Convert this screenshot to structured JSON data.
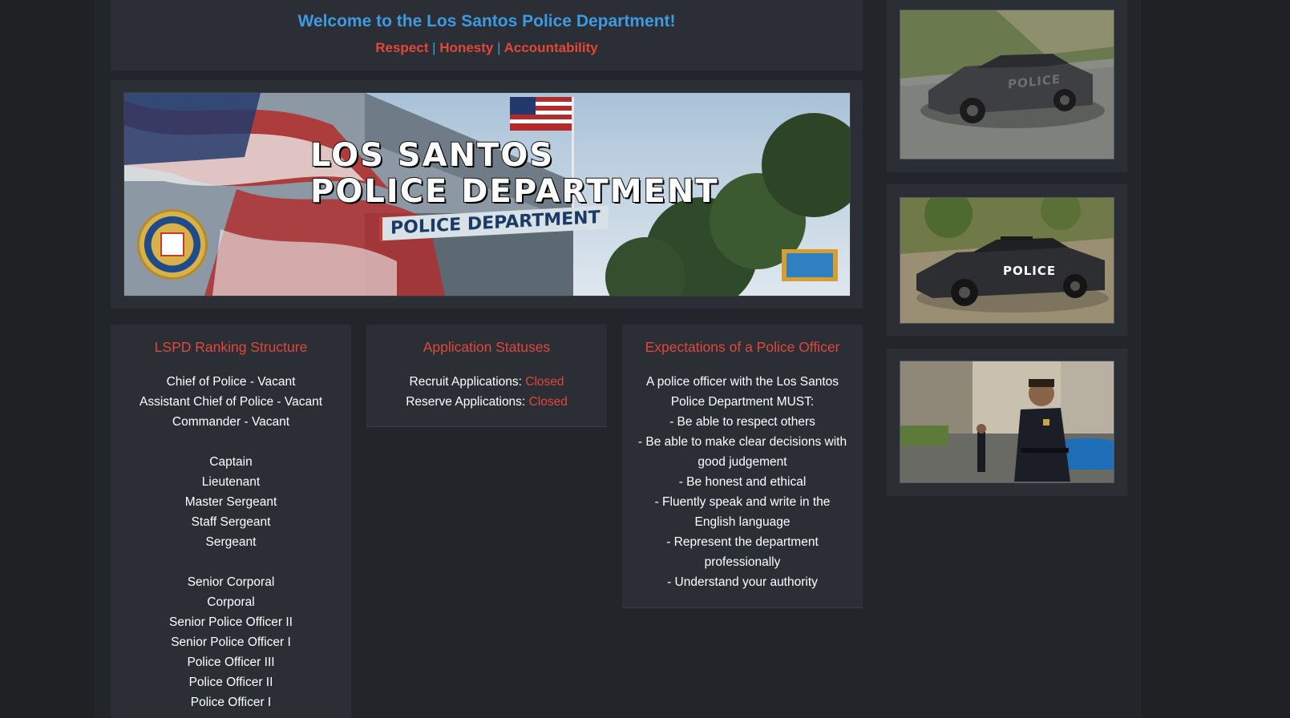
{
  "header": {
    "title": "Welcome to the Los Santos Police Department!",
    "values": [
      "Respect",
      "Honesty",
      "Accountability"
    ],
    "separator": "|"
  },
  "banner": {
    "line1": "LOS SANTOS",
    "line2": "POLICE DEPARTMENT",
    "sign": "POLICE DEPARTMENT"
  },
  "ranking": {
    "title": "LSPD Ranking Structure",
    "groups": [
      [
        "Chief of Police - Vacant",
        "Assistant Chief of Police - Vacant",
        "Commander - Vacant"
      ],
      [
        "Captain",
        "Lieutenant",
        "Master Sergeant",
        "Staff Sergeant",
        "Sergeant"
      ],
      [
        "Senior Corporal",
        "Corporal",
        "Senior Police Officer II",
        "Senior Police Officer I",
        "Police Officer III",
        "Police Officer II",
        "Police Officer I"
      ]
    ]
  },
  "applications": {
    "title": "Application Statuses",
    "recruit_label": "Recruit Applications:",
    "recruit_status": "Closed",
    "reserve_label": "Reserve Applications:",
    "reserve_status": "Closed"
  },
  "expectations": {
    "title": "Expectations of a Police Officer",
    "lines": [
      "A police officer with the Los Santos Police Department MUST:",
      "- Be able to respect others",
      "- Be able to make clear decisions with good judgement",
      "- Be honest and ethical",
      "- Fluently speak and write in the English language",
      "- Represent the department professionally",
      "- Understand your authority"
    ]
  },
  "side_images": {
    "car1_text": "POLICE",
    "car2_text": "POLICE"
  },
  "colors": {
    "accent_blue": "#3c9be0",
    "accent_red": "#e2473a",
    "panel": "#2b2e34",
    "background": "#1f2125"
  }
}
